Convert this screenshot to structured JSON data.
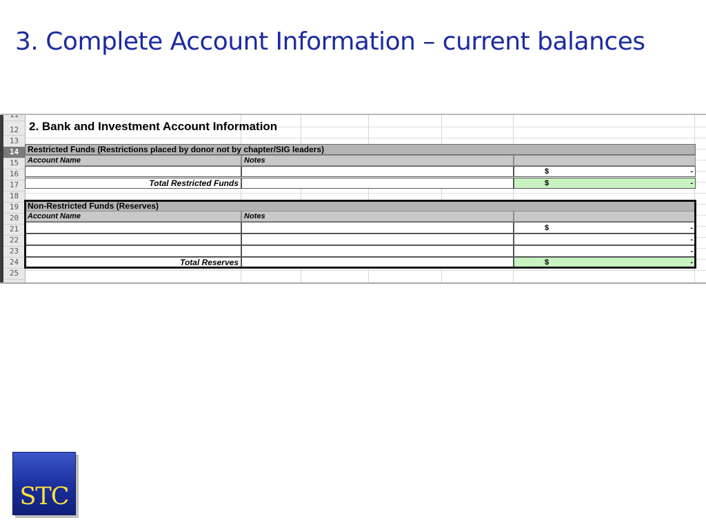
{
  "slide": {
    "title": "3. Complete Account Information – current balances"
  },
  "spreadsheet": {
    "row_numbers": [
      "11",
      "12",
      "13",
      "14",
      "15",
      "16",
      "17",
      "18",
      "19",
      "20",
      "21",
      "22",
      "23",
      "24",
      "25"
    ],
    "selected_row": "14",
    "section_title": "2. Bank and Investment Account Information",
    "restricted": {
      "band_label": "Restricted Funds (Restrictions placed by donor not by chapter/SIG leaders)",
      "col_account": "Account Name",
      "col_notes": "Notes",
      "row16": {
        "currency": "$",
        "value": "-"
      },
      "total_label": "Total Restricted Funds",
      "total": {
        "currency": "$",
        "value": "-"
      }
    },
    "reserves": {
      "band_label": "Non-Restricted Funds (Reserves)",
      "col_account": "Account Name",
      "col_notes": "Notes",
      "row21": {
        "currency": "$",
        "value": "-"
      },
      "row22": {
        "value": "-"
      },
      "row23": {
        "value": "-"
      },
      "total_label": "Total Reserves",
      "total": {
        "currency": "$",
        "value": "-"
      }
    },
    "colors": {
      "total_fill": "#c8f2c0",
      "band_fill": "#b4b4b4"
    }
  },
  "logo": {
    "text": "STC",
    "colors": {
      "background": "#1a2e9a",
      "text": "#ffe23a"
    }
  }
}
